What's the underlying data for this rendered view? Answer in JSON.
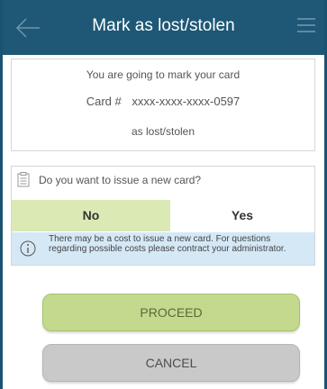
{
  "header": {
    "title": "Mark as lost/stolen",
    "back_icon": "arrow-left-icon",
    "menu_icon": "hamburger-menu-icon",
    "background_color": "#1e5876"
  },
  "notice": {
    "line1": "You are going to mark your card",
    "card_label": "Card #",
    "card_number": "xxxx-xxxx-xxxx-0597",
    "line3": "as lost/stolen"
  },
  "new_card": {
    "question_icon": "clipboard-icon",
    "question": "Do you want to issue a new card?",
    "options": [
      "No",
      "Yes"
    ],
    "selected": "No",
    "selected_color": "#dbe9b5",
    "info_icon": "info-icon",
    "info_text": "There may be a cost to issue a new card. For questions regarding possible costs please contract your administrator."
  },
  "actions": {
    "proceed_label": "PROCEED",
    "cancel_label": "CANCEL",
    "proceed_color": "#c2d98e",
    "cancel_color": "#c9c9c9"
  }
}
